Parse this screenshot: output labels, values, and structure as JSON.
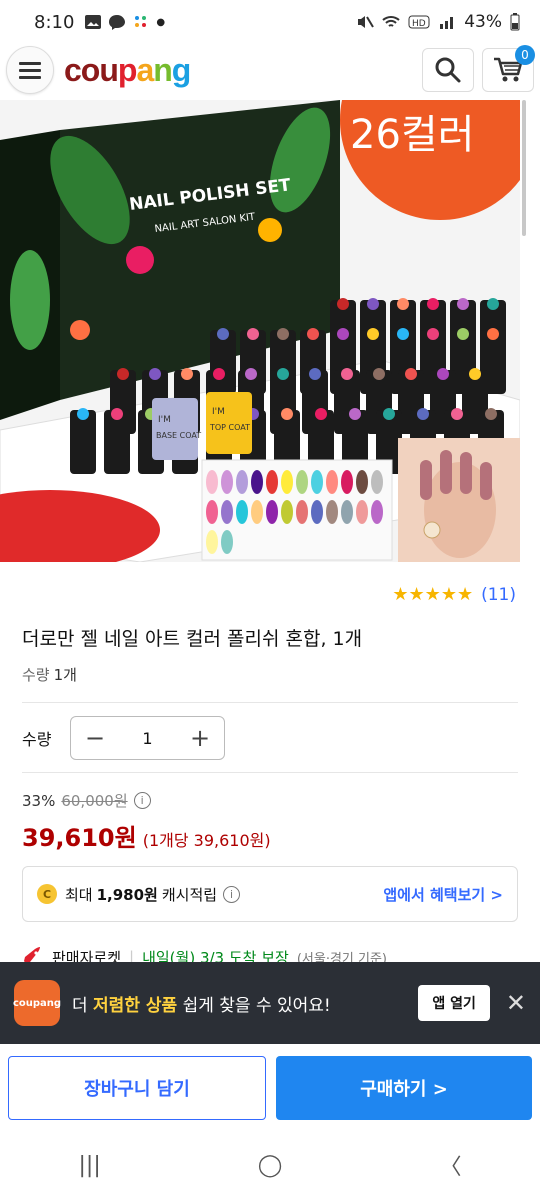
{
  "status_bar": {
    "time": "8:10",
    "battery": "43%",
    "icons": [
      "gallery-icon",
      "messenger-icon",
      "dots-icon",
      "dot-icon",
      "mute-icon",
      "wifi-icon",
      "hd-icon",
      "signal-icon",
      "battery-icon"
    ]
  },
  "header": {
    "logo": [
      "c",
      "o",
      "u",
      "p",
      "a",
      "n",
      "g"
    ],
    "logo_colors": [
      "#8b1a1a",
      "#8b1a1a",
      "#8b1a1a",
      "#e0212e",
      "#f4a51c",
      "#76bc2d",
      "#1ba0e2"
    ],
    "cart_count": "0"
  },
  "hero": {
    "box_title": "NAIL POLISH SET",
    "box_subtitle": "NAIL ART SALON KIT",
    "badge_text": "26컬러",
    "base_coat": "BASE COAT",
    "top_coat": "TOP COAT",
    "im": "I'M"
  },
  "rating": {
    "stars": 5,
    "count": "(11)"
  },
  "product": {
    "title": "더로만 젤 네일 아트 컬러 폴리쉬 혼합, 1개",
    "qty_label": "수량",
    "qty_value": "1개"
  },
  "quantity": {
    "label": "수량",
    "value": "1",
    "minus": "−",
    "plus": "+"
  },
  "pricing": {
    "discount": "33%",
    "original": "60,000원",
    "price": "39,610원",
    "unit_price": "(1개당 39,610원)"
  },
  "cash": {
    "prefix": "최대",
    "amount": "1,980원",
    "suffix": "캐시적립",
    "link": "앱에서 혜택보기 >"
  },
  "delivery": {
    "label": "판매자로켓",
    "date": "내일(월) 3/3 도착 보장",
    "region": "(서울·경기 기준)"
  },
  "app_banner": {
    "logo_text": "coupang",
    "text_pre": "더",
    "text_highlight": "저렴한 상품",
    "text_post": "쉽게 찾을 수 있어요!",
    "open_button": "앱 열기",
    "close": "✕"
  },
  "bottom_bar": {
    "cart_button": "장바구니 담기",
    "buy_button": "구매하기 >"
  },
  "nav_bar": {
    "recent": "|||",
    "home": "◯",
    "back": "〈"
  }
}
